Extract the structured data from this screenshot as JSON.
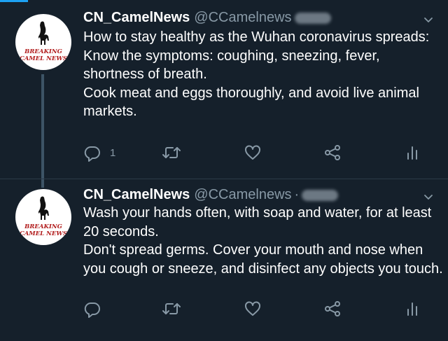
{
  "tweets": [
    {
      "avatar": {
        "line1": "BREAKING",
        "line2": "CAMEL NEWS"
      },
      "display_name": "CN_CamelNews",
      "handle": "@CCamelnews",
      "lines": [
        "How to stay healthy as the Wuhan coronavirus spreads:",
        "Know the symptoms: coughing, sneezing, fever,",
        "shortness of breath.",
        "Cook meat and eggs thoroughly, and avoid live animal",
        "markets."
      ],
      "reply_count": "1"
    },
    {
      "avatar": {
        "line1": "BREAKING",
        "line2": "CAMEL NEWS"
      },
      "display_name": "CN_CamelNews",
      "handle": "@CCamelnews",
      "separator": "·",
      "lines": [
        "Wash your hands often, with soap and water, for at least",
        "20 seconds.",
        "Don't spread germs. Cover your mouth and nose when",
        "you cough or sneeze, and disinfect any objects you touch."
      ]
    }
  ],
  "icons": {
    "reply": "reply-icon",
    "retweet": "retweet-icon",
    "like": "like-icon",
    "share": "share-icon",
    "analytics": "analytics-icon",
    "menu": "chevron-down-icon"
  },
  "colors": {
    "background": "#15202b",
    "text": "#ffffff",
    "secondary": "#8899a6",
    "accent": "#1da1f2",
    "avatar_text": "#b21d1d"
  }
}
